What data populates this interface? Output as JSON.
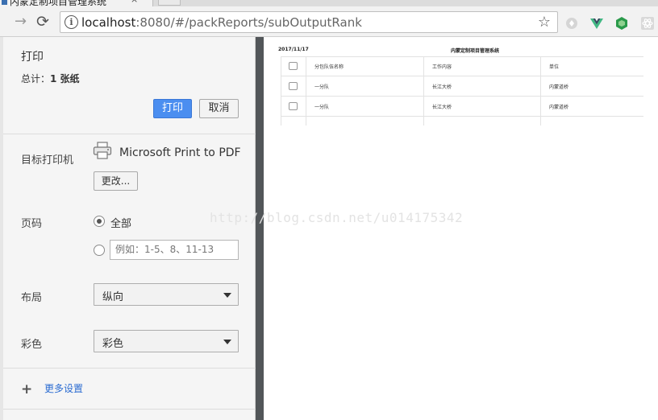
{
  "browser": {
    "tab_title": "内蒙定制项目管理系统",
    "tab_close": "×",
    "address": {
      "host": "localhost",
      "path": ":8080/#/packReports/subOutputRank"
    },
    "info_icon": "i",
    "star_icon": "☆",
    "icons": [
      "back-arrow-icon",
      "forward-arrow-icon",
      "reload-icon",
      "star-icon",
      "extension-icons"
    ]
  },
  "print_panel": {
    "title": "打印",
    "total_label": "总计：",
    "total_value": "1 张纸",
    "print_button": "打印",
    "cancel_button": "取消",
    "destination_label": "目标打印机",
    "printer_name": "Microsoft Print to PDF",
    "change_button": "更改...",
    "pages_label": "页码",
    "pages_all": "全部",
    "pages_placeholder": "例如：1-5、8、11-13",
    "layout_label": "布局",
    "layout_value": "纵向",
    "color_label": "彩色",
    "color_value": "彩色",
    "more_settings": "更多设置",
    "accent_color": "#4b8ef0"
  },
  "preview": {
    "date": "2017/11/17",
    "title": "内蒙定制项目管理系统",
    "headers": [
      "分包队伍名称",
      "工作内容",
      "单位"
    ],
    "rows": [
      [
        "一分队",
        "长江大桥",
        "内蒙道桥"
      ],
      [
        "一分队",
        "长江大桥",
        "内蒙道桥"
      ]
    ]
  },
  "watermark": "http://blog.csdn.net/u014175342"
}
